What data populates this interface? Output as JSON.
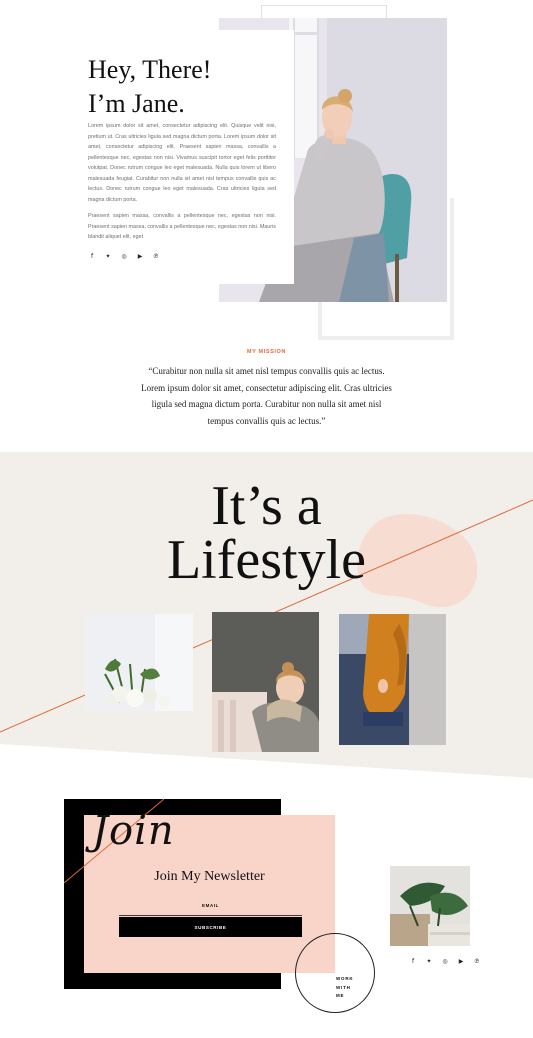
{
  "hero": {
    "title_line1": "Hey, There!",
    "title_line2": "I’m Jane.",
    "paragraph1": "Lorem ipsum dolor sit amet, consectetur adipiscing elit. Quisque velit nisi, pretium ut. Cras ultricies ligula sed magna dictum porta. Lorem ipsum dolor sit amet, consectetur adipiscing elit. Praesent sapien massa, convallis a pellentesque nec, egestas non nisi. Vivamus suscipit tortor eget felis porttitor volutpat. Donec rutrum congue leo eget malesuada. Nulla quis lorem ut libero malesuada feugiat. Curabitur non nulla sit amet nisl tempus convallis quis ac lectus. Donec rutrum congue leo eget malesuada. Cras ultricies ligula sed magna dictum porta.",
    "paragraph2": "Praesent sapien massa, convallis a pellentesque nec, egestas non nisi. Praesent sapien massa, convallis a pellentesque nec, egestas non nisi. Mauris blandit aliquet elit, eget",
    "socials": [
      {
        "icon": "facebook-icon",
        "glyph": "f"
      },
      {
        "icon": "twitter-icon",
        "glyph": "✦"
      },
      {
        "icon": "instagram-icon",
        "glyph": "◎"
      },
      {
        "icon": "youtube-icon",
        "glyph": "▶"
      },
      {
        "icon": "pinterest-icon",
        "glyph": "℗"
      }
    ]
  },
  "mission": {
    "kicker": "MY MISSION",
    "quote": "“Curabitur non nulla sit amet nisl tempus convallis quis ac lectus. Lorem ipsum dolor sit amet, consectetur adipiscing elit. Cras ultricies ligula sed magna dictum porta. Curabitur non nulla sit amet nisl tempus convallis quis ac lectus.”"
  },
  "lifestyle": {
    "line1": "It’s a",
    "line2": "Lifestyle"
  },
  "newsletter": {
    "script": "Join",
    "title": "Join My Newsletter",
    "email_label": "EMAIL",
    "email_value": "",
    "subscribe_label": "SUBSCRIBE",
    "work_line1": "WORK",
    "work_line2": "WITH",
    "work_line3": "ME"
  },
  "colors": {
    "accent": "#e06a3a",
    "band": "#f2efeb",
    "blob": "#f7dcd2",
    "pink": "#f9d4c8"
  }
}
